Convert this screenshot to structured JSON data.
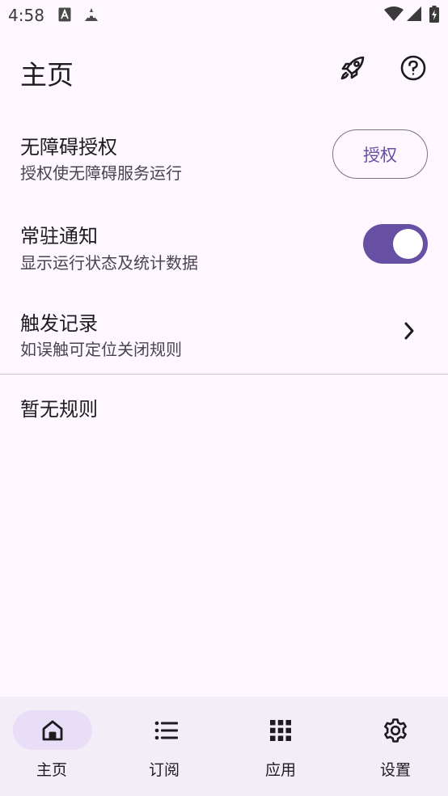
{
  "status_bar": {
    "time": "4:58"
  },
  "header": {
    "title": "主页",
    "action_icons": [
      "rocket-icon",
      "help-icon"
    ]
  },
  "settings": {
    "accessibility": {
      "title": "无障碍授权",
      "subtitle": "授权使无障碍服务运行",
      "button_label": "授权"
    },
    "notification": {
      "title": "常驻通知",
      "subtitle": "显示运行状态及统计数据",
      "enabled": true
    },
    "trigger_log": {
      "title": "触发记录",
      "subtitle": "如误触可定位关闭规则"
    }
  },
  "rules": {
    "empty_text": "暂无规则"
  },
  "bottom_nav": {
    "items": [
      {
        "label": "主页",
        "icon": "home-icon",
        "selected": true
      },
      {
        "label": "订阅",
        "icon": "list-icon",
        "selected": false
      },
      {
        "label": "应用",
        "icon": "apps-grid-icon",
        "selected": false
      },
      {
        "label": "设置",
        "icon": "gear-icon",
        "selected": false
      }
    ]
  },
  "colors": {
    "background": "#FEF7FF",
    "primary": "#6750A4",
    "nav_background": "#F3EDF7",
    "nav_indicator": "#E8DEF8"
  }
}
